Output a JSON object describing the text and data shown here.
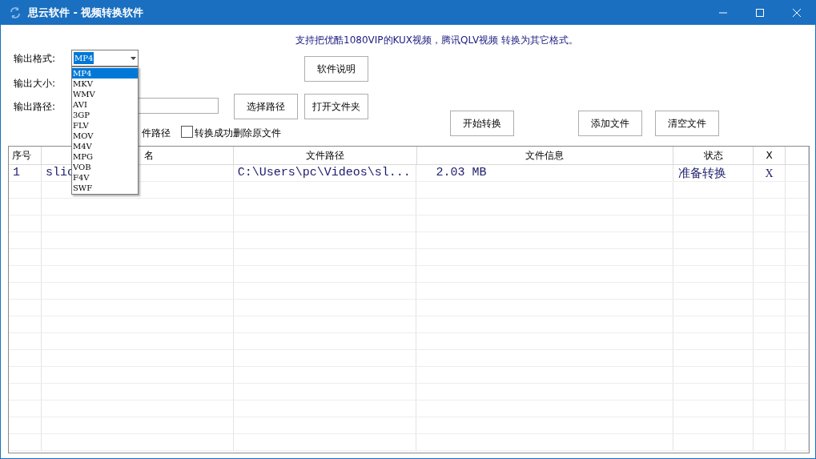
{
  "window": {
    "title": "思云软件 - 视频转换软件"
  },
  "notice": "支持把优酷1080VIP的KUX视频，腾讯QLV视频 转换为其它格式。",
  "form": {
    "format_label": "输出格式:",
    "size_label": "输出大小:",
    "path_label": "输出路径:",
    "format_value": "MP4"
  },
  "format_options": [
    {
      "label": "MP4",
      "selected": true
    },
    {
      "label": "MKV",
      "selected": false
    },
    {
      "label": "WMV",
      "selected": false
    },
    {
      "label": "AVI",
      "selected": false
    },
    {
      "label": "3GP",
      "selected": false
    },
    {
      "label": "FLV",
      "selected": false
    },
    {
      "label": "MOV",
      "selected": false
    },
    {
      "label": "M4V",
      "selected": false
    },
    {
      "label": "MPG",
      "selected": false
    },
    {
      "label": "VOB",
      "selected": false
    },
    {
      "label": "F4V",
      "selected": false
    },
    {
      "label": "SWF",
      "selected": false
    }
  ],
  "buttons": {
    "help": "软件说明",
    "choose_path": "选择路径",
    "open_folder": "打开文件夹",
    "start": "开始转换",
    "add": "添加文件",
    "clear": "清空文件"
  },
  "partial_label": "件路径",
  "delete_option": {
    "label": "转换成功删除原文件",
    "checked": false
  },
  "table": {
    "columns": [
      "序号",
      "名",
      "文件路径",
      "文件信息",
      "状态",
      "X"
    ],
    "rows": [
      {
        "cells": [
          "1",
          "slic",
          "C:\\Users\\pc\\Videos\\sl...",
          "2.03 MB",
          "准备转换",
          "X"
        ]
      }
    ]
  }
}
